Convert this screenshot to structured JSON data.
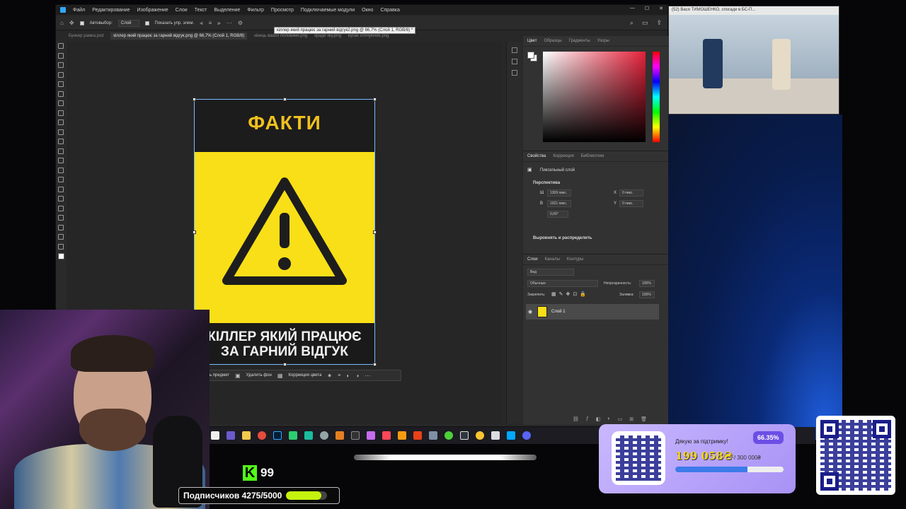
{
  "photoshop": {
    "menu": [
      "Файл",
      "Редактирование",
      "Изображение",
      "Слои",
      "Текст",
      "Выделение",
      "Фильтр",
      "Просмотр",
      "Подключаемые модули",
      "Окно",
      "Справка"
    ],
    "options": {
      "autoselect_label": "Автовыбор:",
      "autoselect_value": "Слой",
      "show_controls_label": "Показать упр. элем."
    },
    "tabs": [
      {
        "label": "Бункер рамка.psd"
      },
      {
        "label": "кіллер який працює за гарний відгук.png @ 66,7% (Слой 1, RGB/8)",
        "active": true
      },
      {
        "label": "кінець вашої половини.png"
      },
      {
        "label": "краде їжу.png"
      },
      {
        "label": "кусає оточуючих.png"
      }
    ],
    "tooltip": "кіллер який працює за гарний відгук2.png @ 66,7% (Слой 1, RGB/8) *",
    "poster": {
      "title": "ФАКТИ",
      "caption_line1": "КІЛЛЕР ЯКИЙ ПРАЦЮЄ",
      "caption_line2": "ЗА ГАРНИЙ ВІДГУК",
      "colors": {
        "yellow": "#f8df17",
        "dark": "#1a1a1a",
        "title": "#f0c01e"
      }
    },
    "context_bar": {
      "select_subject": "ь предмет",
      "remove_bg": "Удалить фон",
      "color_correction": "Коррекция цвета"
    },
    "color_panel": {
      "tabs": [
        "Цвет",
        "Образцы",
        "Градиенты",
        "Узоры"
      ],
      "accent": "#e5213a"
    },
    "properties_panel": {
      "tabs": [
        "Свойства",
        "Коррекция",
        "Библиотеки"
      ],
      "layer_type": "Пиксельный слой",
      "section_perspective": "Перспектива",
      "w_label": "Ш",
      "w_value": "1309 пикс.",
      "h_label": "В",
      "h_value": "1921 пикс.",
      "x_label": "X",
      "x_value": "0 пикс.",
      "y_label": "Y",
      "y_value": "0 пикс.",
      "angle_value": "0,00°",
      "section_align": "Выровнять и распределить"
    },
    "layers_panel": {
      "tabs": [
        "Слои",
        "Каналы",
        "Контуры"
      ],
      "filter_value": "Вид",
      "blend_mode": "Обычные",
      "opacity_label": "Непрозрачность:",
      "opacity_value": "100%",
      "lock_label": "Закрепить:",
      "fill_label": "Заливка:",
      "fill_value": "100%",
      "layer_name": "Слой 1"
    }
  },
  "video": {
    "title_bar": "(52) Вася ТИМОШЕНКО, спогади в БС-П..."
  },
  "stream": {
    "kick_count": "99",
    "subs_label": "Подписчиков 4275/5000",
    "subs_progress": 0.855
  },
  "donation": {
    "thanks_text": "Дякую за підтримку!",
    "percent": "66.35%",
    "amount": "199 058₴",
    "goal": "/ 300 000₴",
    "progress": 0.6635
  }
}
